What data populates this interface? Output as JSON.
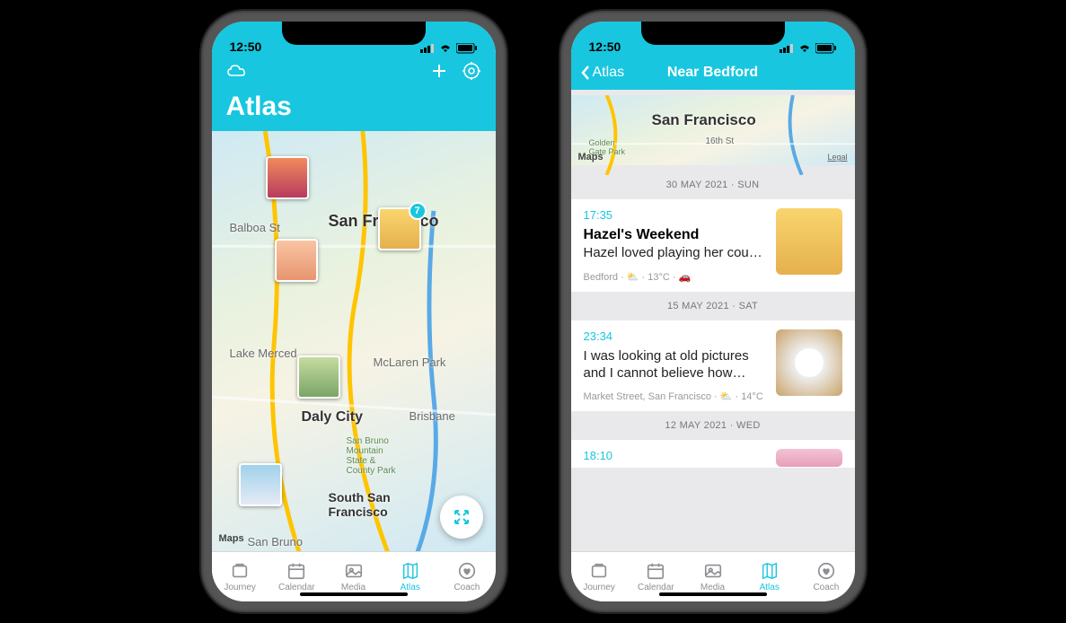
{
  "statusbar": {
    "time": "12:50"
  },
  "phone1": {
    "header": {
      "title": "Atlas"
    },
    "map": {
      "city": "San Francisco",
      "labels": {
        "balboa": "Balboa St",
        "daly": "Daly City",
        "south_sf": "South San\nFrancisco",
        "brisbane": "Brisbane",
        "lake_merced": "Lake Merced",
        "mclaren": "McLaren Park",
        "san_bruno": "San Bruno",
        "park": "San Bruno\nMountain\nState &\nCounty Park"
      },
      "attribution": "Maps",
      "badge": "7"
    }
  },
  "phone2": {
    "header": {
      "back": "Atlas",
      "title": "Near Bedford"
    },
    "mini_map": {
      "city": "San Francisco",
      "label16": "16th St",
      "attribution": "Maps",
      "legal": "Legal",
      "gate": "Golden\nGate Park"
    },
    "entries": [
      {
        "date": "30 MAY 2021 · SUN",
        "time": "17:35",
        "title": "Hazel's Weekend",
        "text": "Hazel loved playing her cousi…",
        "meta": "Bedford · ⛅ · 13°C · 🚗"
      },
      {
        "date": "15 MAY 2021 · SAT",
        "time": "23:34",
        "title": "",
        "text": "I was looking at old pictures and I cannot believe how tiny…",
        "meta": "Market Street, San Francisco · ⛅ · 14°C"
      },
      {
        "date": "12 MAY 2021 · WED",
        "time": "18:10",
        "title": "",
        "text": "",
        "meta": ""
      }
    ]
  },
  "tabs": [
    {
      "label": "Journey"
    },
    {
      "label": "Calendar"
    },
    {
      "label": "Media"
    },
    {
      "label": "Atlas"
    },
    {
      "label": "Coach"
    }
  ]
}
